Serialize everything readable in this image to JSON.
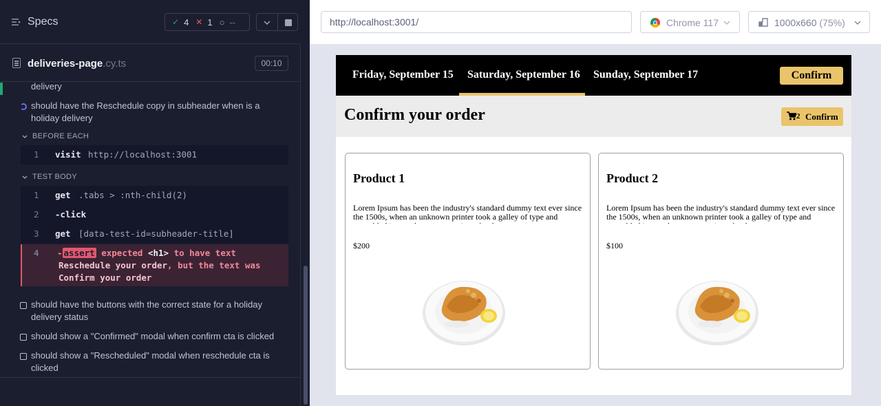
{
  "reporter": {
    "title": "Specs",
    "stats": {
      "passed": "4",
      "failed": "1",
      "pending": "--"
    },
    "spec": {
      "name": "deliveries-page",
      "ext": ".cy.ts",
      "duration": "00:10"
    },
    "tests": {
      "prev_tail": "delivery",
      "current": [
        "should have the Reschedule copy in subheader when is a",
        "holiday delivery"
      ],
      "before_each_label": "BEFORE EACH",
      "before_each": [
        {
          "num": "1",
          "name": "visit",
          "message": "http://localhost:3001"
        }
      ],
      "test_body_label": "TEST BODY",
      "test_body": [
        {
          "num": "1",
          "name": "get",
          "message": ".tabs > :nth-child(2)"
        },
        {
          "num": "2",
          "name": "-click",
          "message": ""
        },
        {
          "num": "3",
          "name": "get",
          "message": "[data-test-id=subheader-title]"
        }
      ],
      "failed_command": {
        "num": "4",
        "dash": "-",
        "badge": "assert",
        "line1_a": " expected ",
        "line1_b": "<h1>",
        "line1_c": " to have text",
        "line2_a": "Reschedule your order",
        "line2_b": ", but the text was",
        "line3": "Confirm your order"
      },
      "pending": [
        [
          "should have the buttons with the correct state for a holiday",
          "delivery status"
        ],
        [
          "should show a \"Confirmed\" modal when confirm cta is clicked"
        ],
        [
          "should show a \"Rescheduled\" modal when reschedule cta is",
          "clicked"
        ]
      ]
    }
  },
  "browser": {
    "url": "http://localhost:3001/",
    "browser_name": "Chrome 117",
    "viewport": "1000x660",
    "scale": "(75%)"
  },
  "aut": {
    "tabs": [
      "Friday, September 15",
      "Saturday, September 16",
      "Sunday, September 17"
    ],
    "active_tab": 1,
    "nav_confirm": "Confirm",
    "subheader_title": "Confirm your order",
    "cart_count": "2",
    "cart_label": "Confirm",
    "products": [
      {
        "title": "Product 1",
        "description": "Lorem Ipsum has been the industry's standard dummy text ever since the 1500s, when an unknown printer took a galley of type and scrambled it to make a type specimen book.",
        "price": "$200"
      },
      {
        "title": "Product 2",
        "description": "Lorem Ipsum has been the industry's standard dummy text ever since the 1500s, when an unknown printer took a galley of type and scrambled it to make a type specimen book.",
        "price": "$100"
      }
    ]
  },
  "colors": {
    "accent": "#e9c46a",
    "pass": "#1fa971",
    "fail": "#e45770",
    "reporter_bg": "#1b1e2e"
  }
}
